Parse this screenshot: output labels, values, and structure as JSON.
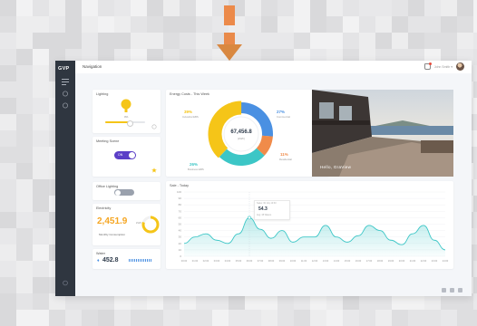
{
  "app": {
    "logo": "GVP",
    "nav_title": "Navigation",
    "user_label": "John Smith ▾"
  },
  "sidebar": {
    "icons": [
      "menu-icon",
      "home-icon",
      "settings-icon",
      "bottom-icon"
    ]
  },
  "lighting": {
    "title": "Lighting",
    "value": "0%"
  },
  "meeting": {
    "title": "Meeting Scene",
    "toggle_label": "ON"
  },
  "office": {
    "title": "Office Lighting"
  },
  "electricity": {
    "title": "Electricity",
    "value": "2,451.9",
    "unit": "kWh",
    "sub": "Monthly Consumption"
  },
  "water": {
    "title": "Water",
    "value": "452.8"
  },
  "energy": {
    "title": "Energy Costs - This Week",
    "center_value": "67,456.8",
    "center_unit": "(kWh)",
    "labels": [
      {
        "pct": "39%",
        "name": "Industrial EBS"
      },
      {
        "pct": "27%",
        "name": "Commercial"
      },
      {
        "pct": "11%",
        "name": "Residential"
      },
      {
        "pct": "26%",
        "name": "Business EBS"
      }
    ],
    "colors": [
      "#f5c518",
      "#4a90e2",
      "#f08b4a",
      "#3cc6c6"
    ]
  },
  "photo": {
    "caption": "Hello, GraView"
  },
  "sales": {
    "title": "Sale - Today",
    "tooltip_line1": "Sales: 30 July 10:30",
    "tooltip_line2": "54.3",
    "tooltip_line3": "Avg: 48 Waters"
  },
  "chart_data": {
    "type": "area",
    "title": "Sale - Today",
    "x": [
      "00:00",
      "01:00",
      "02:00",
      "03:00",
      "04:00",
      "05:00",
      "06:00",
      "07:00",
      "08:00",
      "09:00",
      "10:00",
      "11:00",
      "12:00",
      "13:00",
      "14:00",
      "15:00",
      "16:00",
      "17:00",
      "18:00",
      "19:00",
      "20:00",
      "21:00",
      "22:00",
      "23:00",
      "24:00"
    ],
    "y_ticks": [
      "0",
      "10",
      "20",
      "30",
      "40",
      "50",
      "60",
      "70",
      "80",
      "90",
      "100"
    ],
    "ylim": [
      0,
      100
    ],
    "series": [
      {
        "values": [
          20,
          30,
          35,
          25,
          20,
          35,
          60,
          42,
          28,
          40,
          22,
          30,
          30,
          48,
          30,
          22,
          32,
          48,
          40,
          25,
          18,
          35,
          48,
          25,
          10
        ]
      }
    ],
    "color": "#3cc6c6",
    "grid": true
  }
}
